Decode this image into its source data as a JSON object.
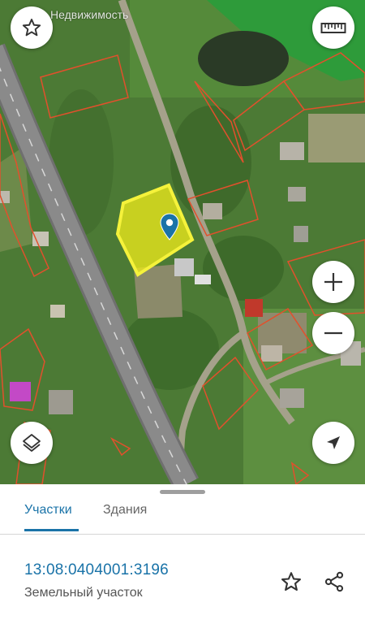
{
  "app": {
    "watermark": "Недвижимость"
  },
  "map": {
    "buttons": {
      "favorite": "star-icon",
      "ruler": "ruler-icon",
      "zoom_in": "plus-icon",
      "zoom_out": "minus-icon",
      "layers": "layers-icon",
      "locate": "navigation-arrow-icon"
    },
    "colors": {
      "parcel_highlight": "#f2ee1a",
      "parcel_border": "#e2502c",
      "pin": "#1a73a8"
    }
  },
  "sheet": {
    "tabs": [
      {
        "label": "Участки",
        "active": true
      },
      {
        "label": "Здания",
        "active": false
      }
    ],
    "parcel": {
      "cadastral_number": "13:08:0404001:3196",
      "type": "Земельный участок"
    },
    "colors": {
      "accent": "#1a73a8"
    }
  }
}
